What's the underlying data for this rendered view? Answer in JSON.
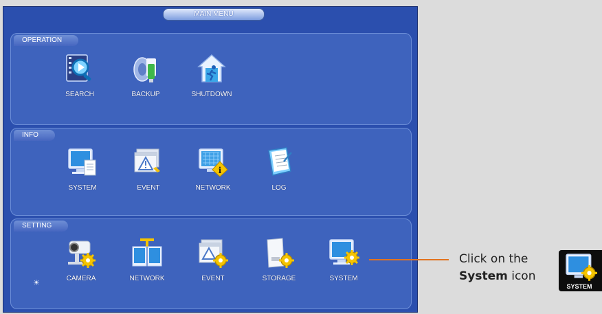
{
  "window": {
    "title": "MAIN MENU"
  },
  "sections": [
    {
      "label": "OPERATION",
      "items": [
        {
          "label": "SEARCH",
          "icon": "search-film-icon"
        },
        {
          "label": "BACKUP",
          "icon": "backup-usb-icon"
        },
        {
          "label": "SHUTDOWN",
          "icon": "shutdown-exit-icon"
        }
      ]
    },
    {
      "label": "INFO",
      "items": [
        {
          "label": "SYSTEM",
          "icon": "monitor-doc-icon"
        },
        {
          "label": "EVENT",
          "icon": "event-warning-icon"
        },
        {
          "label": "NETWORK",
          "icon": "network-info-icon"
        },
        {
          "label": "LOG",
          "icon": "log-book-icon"
        }
      ]
    },
    {
      "label": "SETTING",
      "items": [
        {
          "label": "CAMERA",
          "icon": "camera-gear-icon"
        },
        {
          "label": "NETWORK",
          "icon": "network-gear-icon"
        },
        {
          "label": "EVENT",
          "icon": "event-gear-icon"
        },
        {
          "label": "STORAGE",
          "icon": "storage-gear-icon"
        },
        {
          "label": "SYSTEM",
          "icon": "system-gear-icon"
        }
      ]
    }
  ],
  "callout": {
    "line1": "Click on the",
    "bold": "System",
    "rest": " icon"
  },
  "preview": {
    "label": "SYSTEM",
    "icon": "system-gear-icon"
  },
  "colors": {
    "window_bg": "#2b4fae",
    "panel_bg": "#3e63bd",
    "callout_line": "#e2731f",
    "gear": "#f5c400"
  }
}
